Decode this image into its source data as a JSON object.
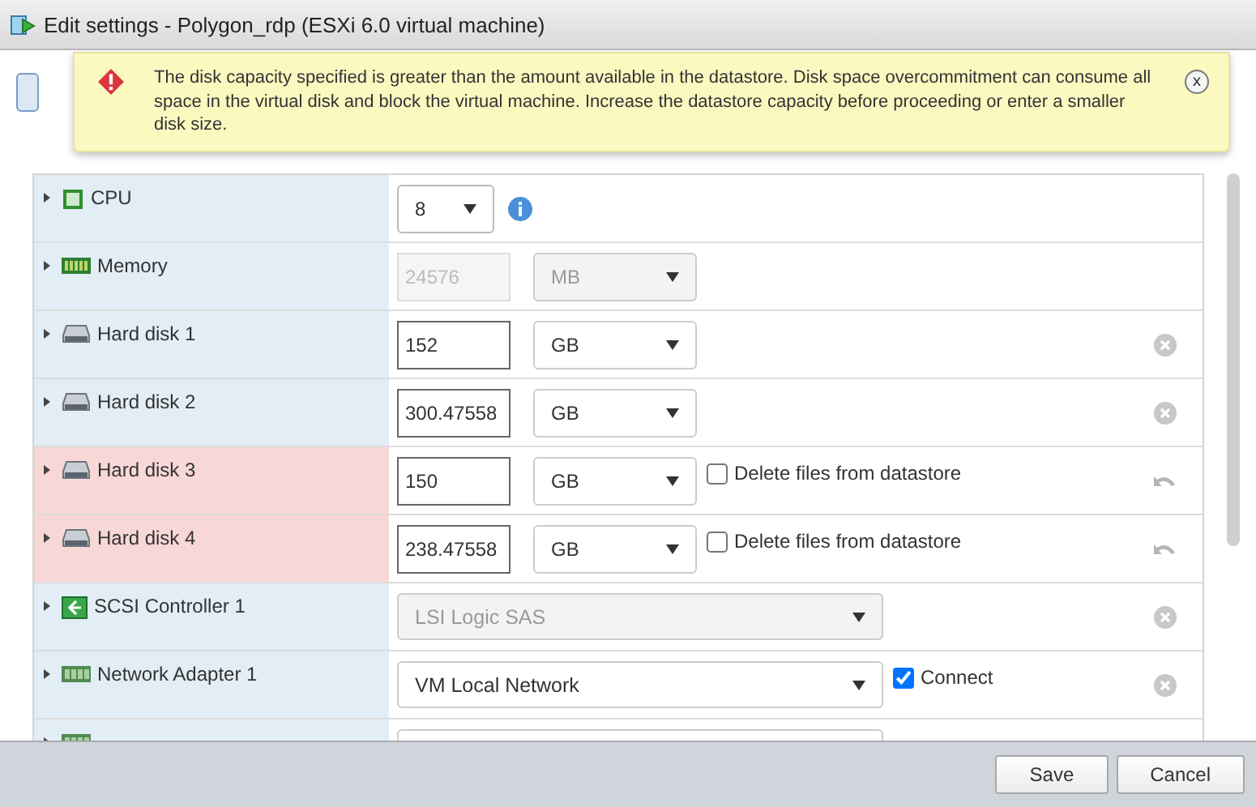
{
  "window": {
    "title": "Edit settings - Polygon_rdp (ESXi 6.0 virtual machine)"
  },
  "alert": {
    "message": "The disk capacity specified is greater than the amount available in the datastore. Disk space overcommitment can consume all space in the virtual disk and block the virtual machine. Increase the datastore capacity before proceeding or enter a smaller disk size.",
    "close": "x"
  },
  "devices": [
    {
      "kind": "cpu",
      "name": "CPU",
      "value": "8",
      "marked_for_removal": false
    },
    {
      "kind": "memory",
      "name": "Memory",
      "value": "24576",
      "unit": "MB",
      "disabled": true,
      "marked_for_removal": false
    },
    {
      "kind": "disk",
      "name": "Hard disk 1",
      "value": "152",
      "unit": "GB",
      "disabled": false,
      "marked_for_removal": false,
      "removable": true
    },
    {
      "kind": "disk",
      "name": "Hard disk 2",
      "value": "300.47558",
      "unit": "GB",
      "disabled": false,
      "marked_for_removal": false,
      "removable": true
    },
    {
      "kind": "disk",
      "name": "Hard disk 3",
      "value": "150",
      "unit": "GB",
      "disabled": false,
      "marked_for_removal": true,
      "delete_files": {
        "label": "Delete files from datastore",
        "checked": false
      },
      "removable": true
    },
    {
      "kind": "disk",
      "name": "Hard disk 4",
      "value": "238.47558",
      "unit": "GB",
      "disabled": false,
      "marked_for_removal": true,
      "delete_files": {
        "label": "Delete files from datastore",
        "checked": false
      },
      "removable": true
    },
    {
      "kind": "controller",
      "name": "SCSI Controller 1",
      "value": "LSI Logic SAS",
      "disabled": true,
      "marked_for_removal": false,
      "removable": true
    },
    {
      "kind": "network",
      "name": "Network Adapter 1",
      "value": "VM Local Network",
      "disabled": false,
      "marked_for_removal": false,
      "connect": {
        "label": "Connect",
        "checked": true
      },
      "removable": true
    },
    {
      "kind": "network",
      "marked_for_removal": false
    }
  ],
  "buttons": [
    "Save",
    "Cancel"
  ]
}
